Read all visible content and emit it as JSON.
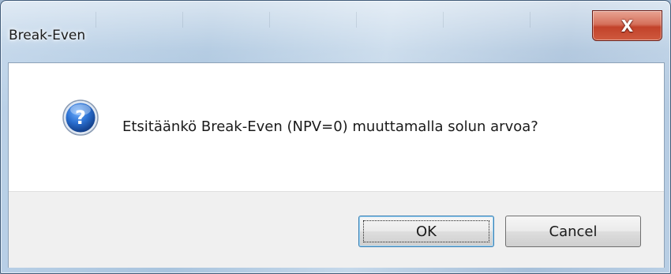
{
  "window": {
    "title": "Break-Even",
    "close_glyph": "X"
  },
  "dialog": {
    "icon": "question-icon",
    "message": "Etsitäänkö Break-Even (NPV=0) muuttamalla solun arvoa?",
    "buttons": {
      "ok": "OK",
      "cancel": "Cancel"
    },
    "default_button": "ok"
  },
  "colors": {
    "icon_blue": "#1f5fb8",
    "close_red": "#c2422a",
    "footer_bg": "#f0f0f0",
    "content_bg": "#ffffff"
  }
}
